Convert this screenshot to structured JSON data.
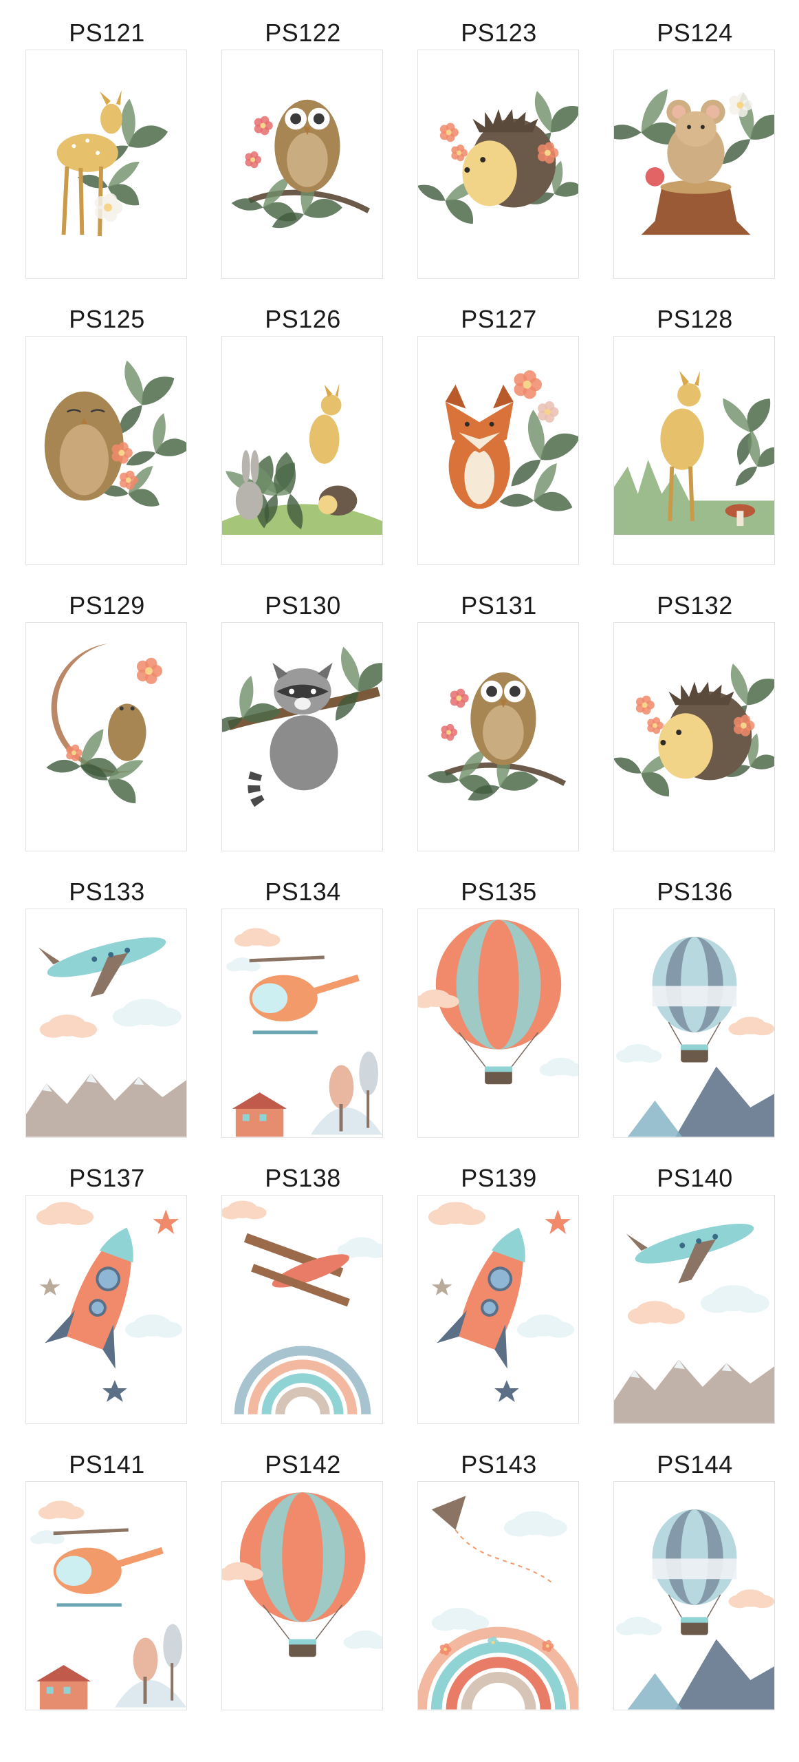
{
  "posters": [
    {
      "code": "PS121",
      "art": "fawn-flowers",
      "theme": "woodland"
    },
    {
      "code": "PS122",
      "art": "owl-branch",
      "theme": "woodland"
    },
    {
      "code": "PS123",
      "art": "hedgehog-berries",
      "theme": "woodland"
    },
    {
      "code": "PS124",
      "art": "mouse-stump",
      "theme": "woodland"
    },
    {
      "code": "PS125",
      "art": "sleeping-owl",
      "theme": "woodland"
    },
    {
      "code": "PS126",
      "art": "bunny-fawn-hedgehog",
      "theme": "woodland"
    },
    {
      "code": "PS127",
      "art": "fox-flowers",
      "theme": "woodland"
    },
    {
      "code": "PS128",
      "art": "fawn-forest",
      "theme": "woodland"
    },
    {
      "code": "PS129",
      "art": "owl-moon",
      "theme": "woodland"
    },
    {
      "code": "PS130",
      "art": "raccoon-branch",
      "theme": "woodland"
    },
    {
      "code": "PS131",
      "art": "owl-branch",
      "theme": "woodland"
    },
    {
      "code": "PS132",
      "art": "hedgehog-berries",
      "theme": "woodland"
    },
    {
      "code": "PS133",
      "art": "airplane-mountains",
      "theme": "travel"
    },
    {
      "code": "PS134",
      "art": "helicopter-house",
      "theme": "travel"
    },
    {
      "code": "PS135",
      "art": "hot-air-balloon-striped",
      "theme": "travel"
    },
    {
      "code": "PS136",
      "art": "hot-air-balloon-blue",
      "theme": "travel"
    },
    {
      "code": "PS137",
      "art": "rocket-stars",
      "theme": "travel"
    },
    {
      "code": "PS138",
      "art": "biplane-rainbow",
      "theme": "travel"
    },
    {
      "code": "PS139",
      "art": "rocket-stars",
      "theme": "travel"
    },
    {
      "code": "PS140",
      "art": "airplane-mountains",
      "theme": "travel"
    },
    {
      "code": "PS141",
      "art": "helicopter-house",
      "theme": "travel"
    },
    {
      "code": "PS142",
      "art": "hot-air-balloon-striped",
      "theme": "travel"
    },
    {
      "code": "PS143",
      "art": "kite-rainbow",
      "theme": "travel"
    },
    {
      "code": "PS144",
      "art": "hot-air-balloon-blue",
      "theme": "travel"
    }
  ],
  "colors": {
    "label": "#1a1a1a",
    "frame_border": "#e2e2e2",
    "leaf": "#4e6b4a",
    "fawn": "#e6c06a",
    "owl": "#a88653",
    "fox": "#d9733a",
    "hedgehog": "#6b5a4a",
    "coral": "#f08a6a",
    "teal": "#8fd3d4",
    "mountain": "#b9aaa0",
    "cloud": "#e8f4f6",
    "peach_cloud": "#fad7c2",
    "navy": "#5b6f86"
  }
}
